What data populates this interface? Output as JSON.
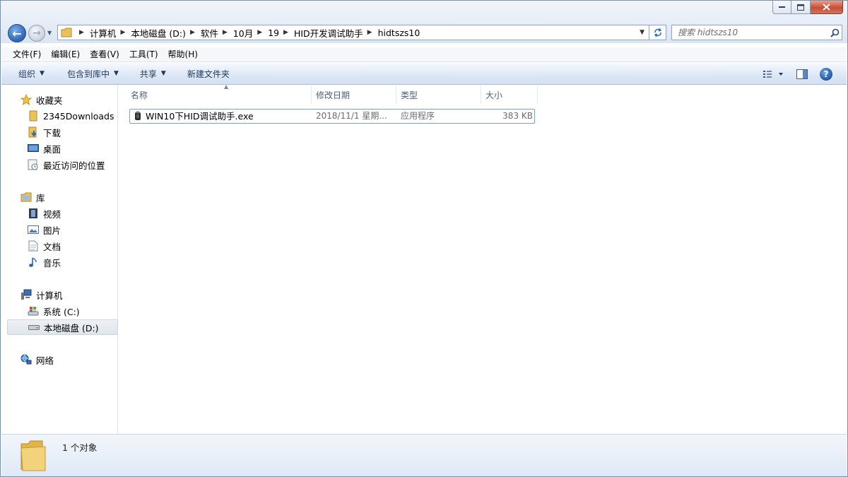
{
  "window": {
    "caption_buttons": [
      "minimize",
      "maximize",
      "close"
    ]
  },
  "address": {
    "crumbs": [
      "计算机",
      "本地磁盘 (D:)",
      "软件",
      "10月",
      "19",
      "HID开发调试助手",
      "hidtszs10"
    ]
  },
  "search": {
    "placeholder": "搜索 hidtszs10"
  },
  "menubar": {
    "items": [
      "文件(F)",
      "编辑(E)",
      "查看(V)",
      "工具(T)",
      "帮助(H)"
    ]
  },
  "toolbar": {
    "organize": "组织",
    "include_library": "包含到库中",
    "share": "共享",
    "new_folder": "新建文件夹"
  },
  "nav": {
    "favorites": {
      "label": "收藏夹",
      "items": [
        "2345Downloads",
        "下载",
        "桌面",
        "最近访问的位置"
      ]
    },
    "libraries": {
      "label": "库",
      "items": [
        "视频",
        "图片",
        "文档",
        "音乐"
      ]
    },
    "computer": {
      "label": "计算机",
      "items": [
        "系统 (C:)",
        "本地磁盘 (D:)"
      ]
    },
    "network": {
      "label": "网络"
    }
  },
  "columns": [
    "名称",
    "修改日期",
    "类型",
    "大小"
  ],
  "files": [
    {
      "name": "WIN10下HID调试助手.exe",
      "date": "2018/11/1 星期...",
      "type": "应用程序",
      "size": "383 KB"
    }
  ],
  "details": {
    "count": "1 个对象"
  },
  "colors": {
    "accent": "#2a64b6",
    "selection_border": "#7da2ce"
  }
}
